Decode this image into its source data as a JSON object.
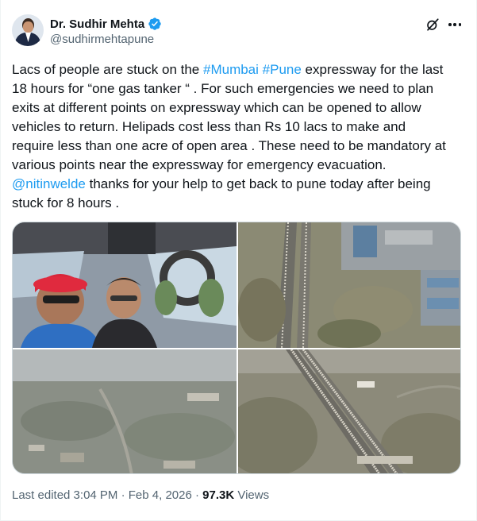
{
  "author": {
    "display_name": "Dr. Sudhir Mehta",
    "handle": "@sudhirmehtapune",
    "verified_color": "#1d9bf0"
  },
  "icons": {
    "verified": "verified-badge-icon",
    "grok": "grok-icon",
    "more": "more-options-icon"
  },
  "tweet": {
    "lines": [
      [
        {
          "text": "Lacs of people are stuck on the ",
          "link": false
        },
        {
          "text": "#Mumbai",
          "link": true
        },
        {
          "text": " ",
          "link": false
        },
        {
          "text": "#Pune",
          "link": true
        },
        {
          "text": " expressway for the last",
          "link": false
        }
      ],
      [
        {
          "text": "18 hours for “one gas tanker “ . For such emergencies we need to plan",
          "link": false
        }
      ],
      [
        {
          "text": "exits at different points on expressway which can be opened to allow",
          "link": false
        }
      ],
      [
        {
          "text": "vehicles to return.  Helipads cost less than Rs 10 lacs to make  and",
          "link": false
        }
      ],
      [
        {
          "text": "require less than one acre of open area . These need to be mandatory at",
          "link": false
        }
      ],
      [
        {
          "text": "various points near the expressway for emergency evacuation.",
          "link": false
        }
      ],
      [
        {
          "text": "@nitinwelde",
          "link": true
        },
        {
          "text": " thanks for your help to get back to pune today after being",
          "link": false
        }
      ],
      [
        {
          "text": "stuck for 8 hours  .",
          "link": false
        }
      ]
    ]
  },
  "media": [
    {
      "name": "helicopter-cockpit-selfie"
    },
    {
      "name": "aerial-expressway-traffic-industrial"
    },
    {
      "name": "aerial-town-haze"
    },
    {
      "name": "aerial-expressway-jam-toll"
    }
  ],
  "meta": {
    "edited": "Last edited 3:04 PM · Feb 4, 2026 · ",
    "views_count": "97.3K",
    "views_label": " Views"
  },
  "colors": {
    "link": "#1d9bf0",
    "text": "#0f1419",
    "secondary": "#536471"
  }
}
